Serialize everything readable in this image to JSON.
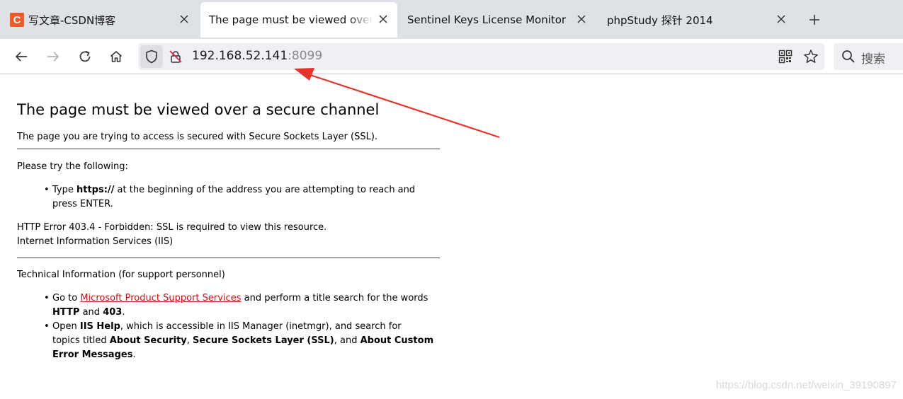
{
  "tabs": [
    {
      "title": "写文章-CSDN博客",
      "favicon_letter": "C"
    },
    {
      "title": "The page must be viewed over a secure channel"
    },
    {
      "title": "Sentinel Keys License Monitor"
    },
    {
      "title": "phpStudy 探针 2014"
    }
  ],
  "toolbar": {
    "url_host": "192.168.52.141",
    "url_port": ":8099",
    "search_label": "搜索"
  },
  "icons": {
    "back": "arrow-left-icon",
    "forward": "arrow-right-icon",
    "reload": "reload-icon",
    "home": "home-icon",
    "shield": "shield-icon",
    "lock": "insecure-lock-icon",
    "qr": "qr-code-icon",
    "star": "star-icon",
    "search": "search-icon",
    "close": "close-icon",
    "plus": "plus-icon"
  },
  "page": {
    "title": "The page must be viewed over a secure channel",
    "intro": "The page you are trying to access is secured with Secure Sockets Layer (SSL).",
    "try_heading": "Please try the following:",
    "try_items": [
      {
        "pre": "Type ",
        "bold": "https://",
        "post_line1": " at the beginning of the address you are attempting to reach and",
        "line2": "press ENTER."
      }
    ],
    "error_line": "HTTP Error 403.4 - Forbidden: SSL is required to view this resource.",
    "server_line": "Internet Information Services (IIS)",
    "tech_heading": "Technical Information (for support personnel)",
    "tech_items": [
      {
        "pre": "Go to ",
        "link": "Microsoft Product Support Services",
        "post_line1": " and perform a title search for the words",
        "bold_a": "HTTP",
        "and": " and ",
        "bold_b": "403",
        "end": "."
      },
      {
        "pre": "Open ",
        "bold_a": "IIS Help",
        "post_line1": ", which is accessible in IIS Manager (inetmgr), and search for",
        "line2_pre": "topics titled ",
        "bold_b": "About Security",
        "comma": ", ",
        "bold_c": "Secure Sockets Layer (SSL)",
        "and": ", and ",
        "bold_d_line2": "About Custom",
        "bold_d_line3": "Error Messages",
        "end": "."
      }
    ]
  },
  "annotation": {
    "arrow_color": "#e8332a"
  },
  "watermark": "https://blog.csdn.net/weixin_39190897",
  "colors": {
    "tabstrip": "#dee1e6",
    "urlbar": "#f0f0f4",
    "link": "#d01010",
    "favicon": "#f05a28"
  }
}
